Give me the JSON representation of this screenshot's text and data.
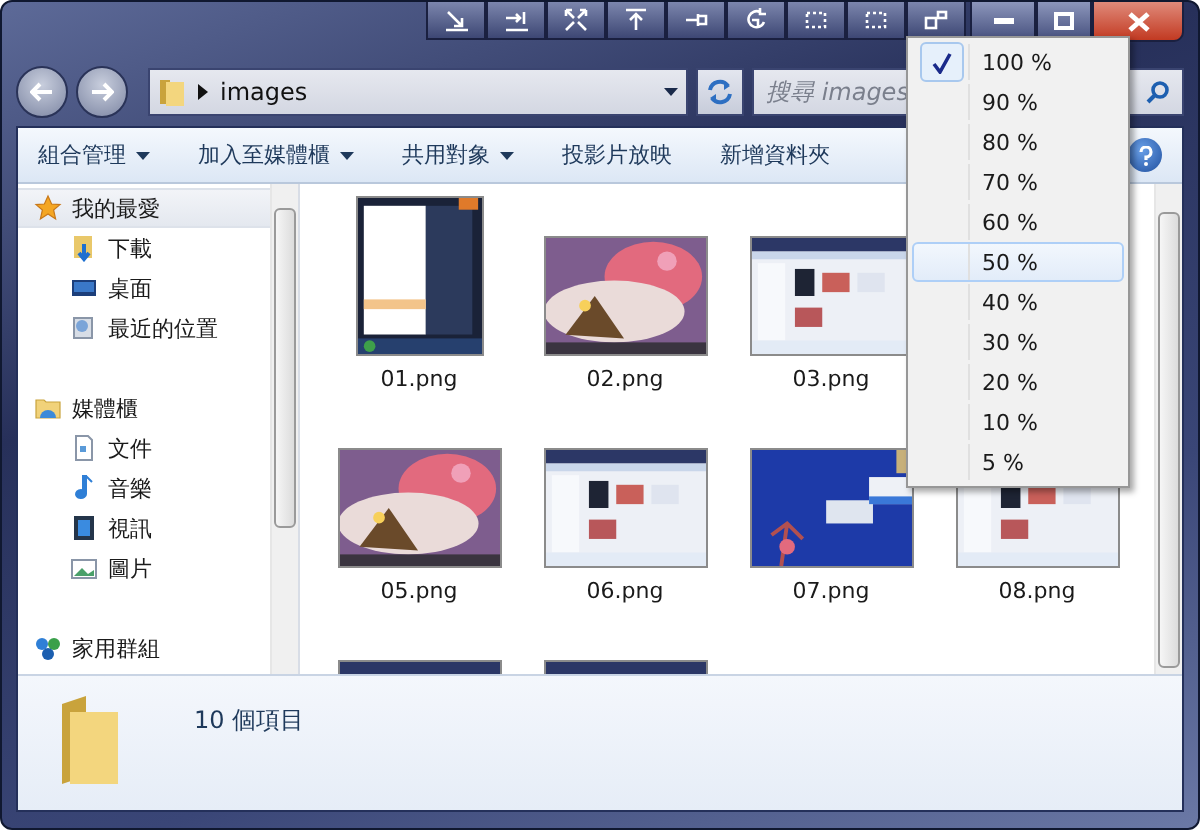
{
  "address": {
    "path": "images"
  },
  "search": {
    "placeholder": "搜尋 images"
  },
  "commands": [
    {
      "label": "組合管理",
      "dropdown": true
    },
    {
      "label": "加入至媒體櫃",
      "dropdown": true
    },
    {
      "label": "共用對象",
      "dropdown": true
    },
    {
      "label": "投影片放映",
      "dropdown": false
    },
    {
      "label": "新增資料夾",
      "dropdown": false
    }
  ],
  "sidebar": {
    "groups": [
      {
        "label": "我的最愛",
        "selected": true,
        "children": [
          {
            "label": "下載"
          },
          {
            "label": "桌面"
          },
          {
            "label": "最近的位置"
          }
        ]
      },
      {
        "label": "媒體櫃",
        "selected": false,
        "children": [
          {
            "label": "文件"
          },
          {
            "label": "音樂"
          },
          {
            "label": "視訊"
          },
          {
            "label": "圖片"
          }
        ]
      },
      {
        "label": "家用群組",
        "selected": false
      }
    ]
  },
  "files": [
    {
      "name": "01.png",
      "kind": "picture"
    },
    {
      "name": "02.png",
      "kind": "picture"
    },
    {
      "name": "03.png",
      "kind": "picture"
    },
    {
      "kind": "covered"
    },
    {
      "name": "05.png",
      "kind": "picture"
    },
    {
      "name": "06.png",
      "kind": "picture"
    },
    {
      "name": "07.png",
      "kind": "picture"
    },
    {
      "name": "08.png",
      "kind": "picture"
    },
    {
      "kind": "picture"
    },
    {
      "kind": "picture"
    }
  ],
  "status_bar": {
    "count": "10 個項目"
  },
  "zoom_menu": [
    {
      "label": "100 %",
      "checked": true,
      "hovered": false
    },
    {
      "label": "90 %",
      "checked": false,
      "hovered": false
    },
    {
      "label": "80 %",
      "checked": false,
      "hovered": false
    },
    {
      "label": "70 %",
      "checked": false,
      "hovered": false
    },
    {
      "label": "60 %",
      "checked": false,
      "hovered": false
    },
    {
      "label": "50 %",
      "checked": false,
      "hovered": true
    },
    {
      "label": "40 %",
      "checked": false,
      "hovered": false
    },
    {
      "label": "30 %",
      "checked": false,
      "hovered": false
    },
    {
      "label": "20 %",
      "checked": false,
      "hovered": false
    },
    {
      "label": "10 %",
      "checked": false,
      "hovered": false
    },
    {
      "label": "5 %",
      "checked": false,
      "hovered": false
    }
  ]
}
